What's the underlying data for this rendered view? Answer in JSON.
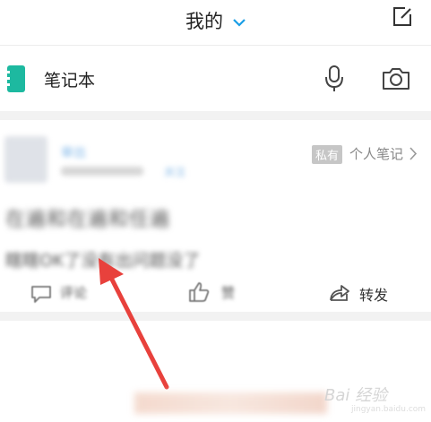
{
  "header": {
    "title": "我的",
    "chevron_icon": "chevron-down-icon",
    "edit_icon": "edit-icon"
  },
  "notebook": {
    "label": "笔记本",
    "icon": "notebook-icon",
    "mic_icon": "microphone-icon",
    "camera_icon": "camera-icon",
    "accent_color": "#1db9a0"
  },
  "note_card": {
    "username": "审出",
    "follow_label": "关注",
    "private_badge": "私有",
    "note_type": "个人笔记",
    "content_line1": "在遍和在遍和任遍",
    "content_line2": "瞎瞎OK了没有出问题没了",
    "actions": {
      "comment": "评论",
      "like": "赞",
      "share": "转发"
    }
  },
  "annotation": {
    "arrow_color": "#e8413c"
  },
  "watermark": {
    "text": "Bai 经验",
    "sub": "jingyan.baidu.com"
  }
}
